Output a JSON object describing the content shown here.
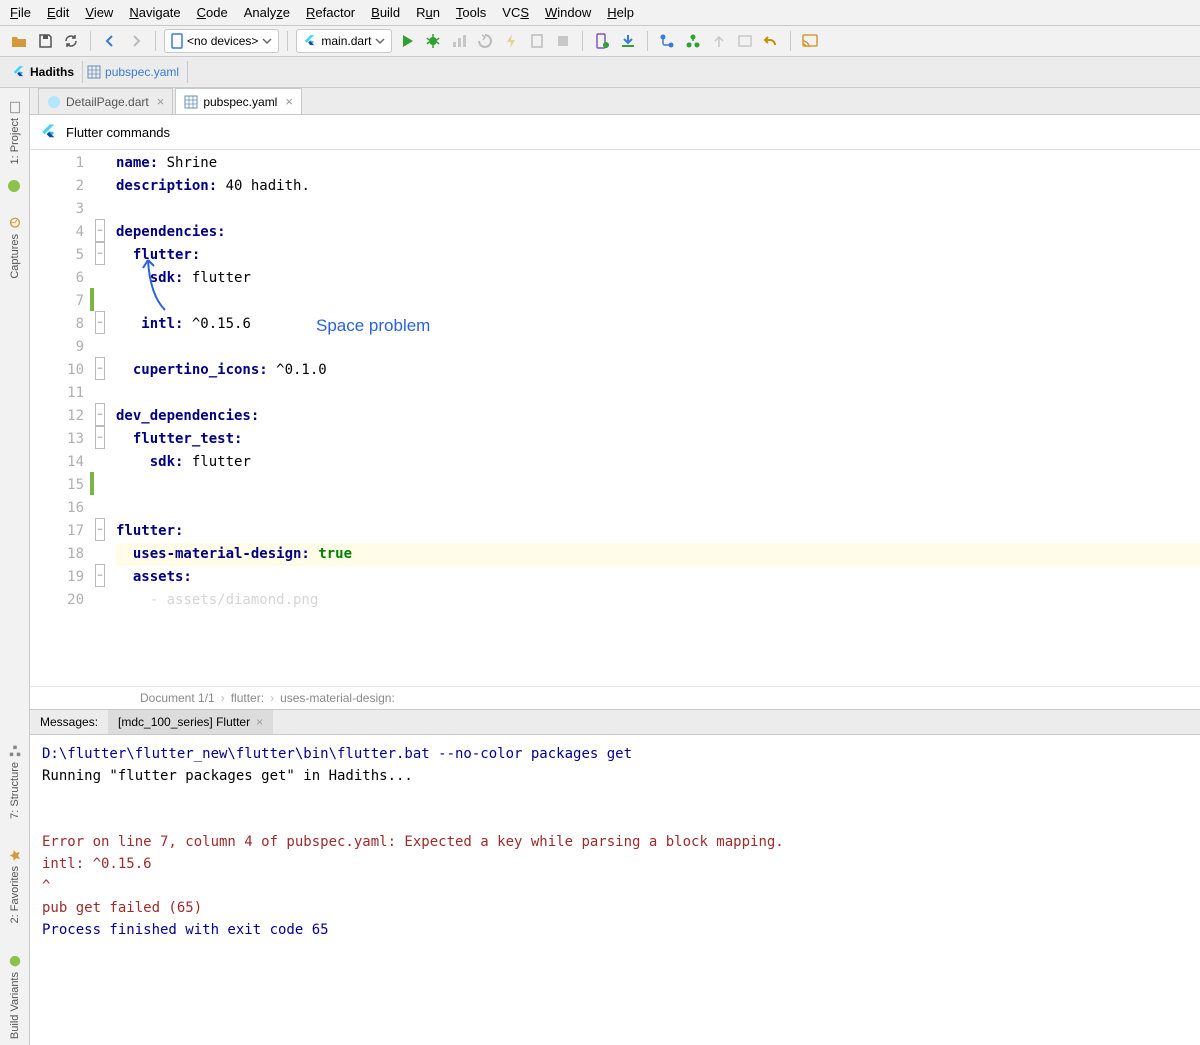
{
  "menu": {
    "items": [
      "File",
      "Edit",
      "View",
      "Navigate",
      "Code",
      "Analyze",
      "Refactor",
      "Build",
      "Run",
      "Tools",
      "VCS",
      "Window",
      "Help"
    ]
  },
  "toolbar": {
    "device_label": "<no devices>",
    "run_config": "main.dart"
  },
  "breadcrumb": {
    "project": "Hadiths",
    "file": "pubspec.yaml"
  },
  "tabs": [
    {
      "label": "DetailPage.dart",
      "active": false
    },
    {
      "label": "pubspec.yaml",
      "active": true
    }
  ],
  "flutter_bar": "Flutter commands",
  "annotation_text": "Space problem",
  "code": {
    "lines": [
      {
        "n": 1,
        "html": "<span class='kw'>name:</span> Shrine"
      },
      {
        "n": 2,
        "html": "<span class='kw'>description:</span> 40 hadith."
      },
      {
        "n": 3,
        "html": ""
      },
      {
        "n": 4,
        "html": "<span class='kw'>dependencies:</span>"
      },
      {
        "n": 5,
        "html": "  <span class='kw'>flutter:</span>"
      },
      {
        "n": 6,
        "html": "    <span class='kw'>sdk:</span> flutter"
      },
      {
        "n": 7,
        "html": ""
      },
      {
        "n": 8,
        "html": "   <span class='kw'>intl:</span> ^0.15.6"
      },
      {
        "n": 9,
        "html": ""
      },
      {
        "n": 10,
        "html": "  <span class='kw'>cupertino_icons:</span> ^0.1.0"
      },
      {
        "n": 11,
        "html": ""
      },
      {
        "n": 12,
        "html": "<span class='kw'>dev_dependencies:</span>"
      },
      {
        "n": 13,
        "html": "  <span class='kw'>flutter_test:</span>"
      },
      {
        "n": 14,
        "html": "    <span class='kw'>sdk:</span> flutter"
      },
      {
        "n": 15,
        "html": ""
      },
      {
        "n": 16,
        "html": ""
      },
      {
        "n": 17,
        "html": "<span class='kw'>flutter:</span>"
      },
      {
        "n": 18,
        "html": "  <span class='kw'>uses-material-design:</span> <span class='str'>true</span>",
        "hl": true
      },
      {
        "n": 19,
        "html": "  <span class='kw'>assets:</span>"
      },
      {
        "n": 20,
        "html": "    <span style='color:#888'>- assets/diamond.png</span>",
        "faded": true
      }
    ]
  },
  "status": {
    "doc": "Document 1/1",
    "path1": "flutter:",
    "path2": "uses-material-design:"
  },
  "messages": {
    "label": "Messages:",
    "tab": "[mdc_100_series] Flutter",
    "lines": [
      {
        "cls": "blue",
        "t": "D:\\flutter\\flutter_new\\flutter\\bin\\flutter.bat --no-color packages get"
      },
      {
        "cls": "",
        "t": "Running \"flutter packages get\" in Hadiths..."
      },
      {
        "cls": "",
        "t": ""
      },
      {
        "cls": "",
        "t": ""
      },
      {
        "cls": "err",
        "t": "Error on line 7, column 4 of pubspec.yaml: Expected a key while parsing a block mapping."
      },
      {
        "cls": "err",
        "t": "   intl: ^0.15.6"
      },
      {
        "cls": "err",
        "t": "   ^"
      },
      {
        "cls": "err",
        "t": "pub get failed (65)"
      },
      {
        "cls": "blue",
        "t": "Process finished with exit code 65"
      }
    ]
  },
  "sidetabs": {
    "project": "1: Project",
    "captures": "Captures",
    "structure": "7: Structure",
    "favorites": "2: Favorites",
    "variants": "Build Variants"
  }
}
